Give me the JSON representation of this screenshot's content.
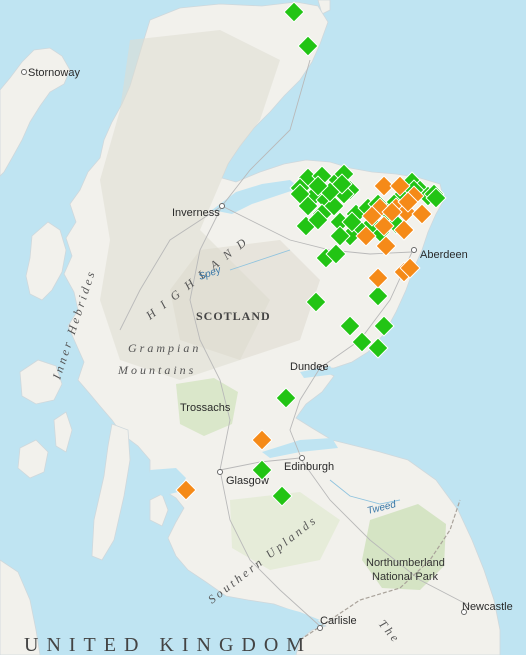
{
  "labels": {
    "stornoway": "Stornoway",
    "inverness": "Inverness",
    "aberdeen": "Aberdeen",
    "dundee": "Dundee",
    "trossachs": "Trossachs",
    "glasgow": "Glasgow",
    "edinburgh": "Edinburgh",
    "carlisle": "Carlisle",
    "newcastle": "Newcastle",
    "scotland": "SCOTLAND",
    "highland": "H I G H L A N D",
    "grampian": "Grampian",
    "mountains": "Mountains",
    "inner_hebrides": "Inner Hebrides",
    "southern_uplands": "Southern Uplands",
    "northumberland": "Northumberland",
    "national_park": "National Park",
    "tweed": "Tweed",
    "spey": "Spey",
    "united_kingdom": "UNITED KINGDOM",
    "pennines": "The"
  },
  "colors": {
    "sea": "#bfe4f2",
    "land": "#f2f1ec",
    "green_marker": "#22c414",
    "orange_marker": "#f58a18"
  },
  "markers": {
    "green_count": 52,
    "orange_count": 19
  }
}
